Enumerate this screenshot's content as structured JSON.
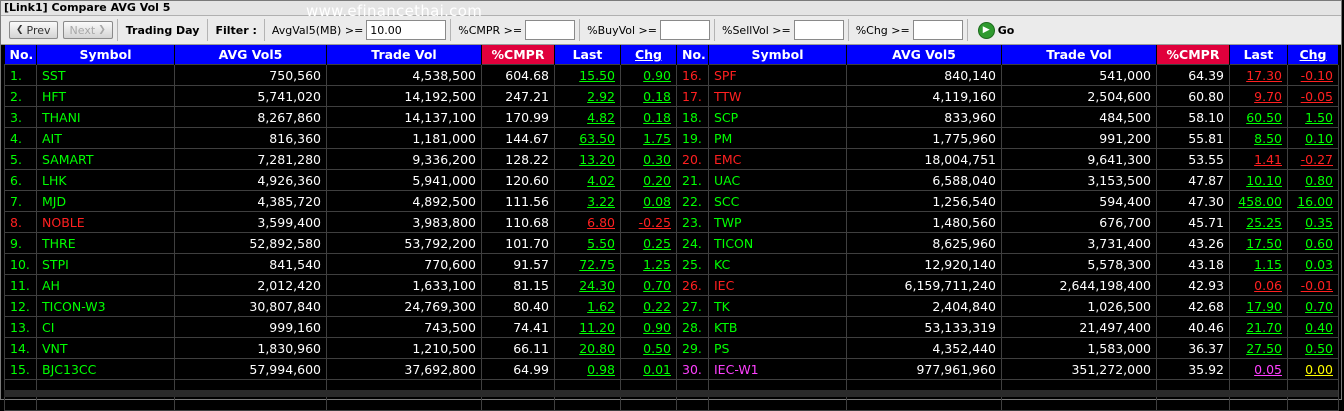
{
  "window": {
    "title": "[Link1] Compare AVG Vol 5"
  },
  "watermark": "www.efinancethai.com",
  "toolbar": {
    "prev_label": "Prev",
    "next_label": "Next",
    "trading_day": "Trading Day",
    "filter_label": "Filter :",
    "avgval_label": "AvgVal5(MB) >=",
    "avgval_value": "10.00",
    "cmpr_label": "%CMPR >=",
    "cmpr_value": "",
    "buyvol_label": "%BuyVol >=",
    "buyvol_value": "",
    "sellvol_label": "%SellVol >=",
    "sellvol_value": "",
    "chg_label": "%Chg >=",
    "chg_value": "",
    "go_label": "Go"
  },
  "colors": {
    "header_bg": "#0000ff",
    "cmpr_header_bg": "#e0003c",
    "up": "#00ff00",
    "down": "#ff2020",
    "ceiling": "#ff40ff",
    "unchanged": "#ffff00"
  },
  "columns": [
    "No.",
    "Symbol",
    "AVG Vol5",
    "Trade Vol",
    "%CMPR",
    "Last",
    "Chg"
  ],
  "rows": [
    [
      {
        "no": "1.",
        "symbol": "SST",
        "avg": "750,560",
        "trade": "4,538,500",
        "cmpr": "604.68",
        "last": "15.50",
        "chg": "0.90",
        "dir": "up"
      },
      {
        "no": "16.",
        "symbol": "SPF",
        "avg": "840,140",
        "trade": "541,000",
        "cmpr": "64.39",
        "last": "17.30",
        "chg": "-0.10",
        "dir": "down"
      }
    ],
    [
      {
        "no": "2.",
        "symbol": "HFT",
        "avg": "5,741,020",
        "trade": "14,192,500",
        "cmpr": "247.21",
        "last": "2.92",
        "chg": "0.18",
        "dir": "up"
      },
      {
        "no": "17.",
        "symbol": "TTW",
        "avg": "4,119,160",
        "trade": "2,504,600",
        "cmpr": "60.80",
        "last": "9.70",
        "chg": "-0.05",
        "dir": "down"
      }
    ],
    [
      {
        "no": "3.",
        "symbol": "THANI",
        "avg": "8,267,860",
        "trade": "14,137,100",
        "cmpr": "170.99",
        "last": "4.82",
        "chg": "0.18",
        "dir": "up"
      },
      {
        "no": "18.",
        "symbol": "SCP",
        "avg": "833,960",
        "trade": "484,500",
        "cmpr": "58.10",
        "last": "60.50",
        "chg": "1.50",
        "dir": "up"
      }
    ],
    [
      {
        "no": "4.",
        "symbol": "AIT",
        "avg": "816,360",
        "trade": "1,181,000",
        "cmpr": "144.67",
        "last": "63.50",
        "chg": "1.75",
        "dir": "up"
      },
      {
        "no": "19.",
        "symbol": "PM",
        "avg": "1,775,960",
        "trade": "991,200",
        "cmpr": "55.81",
        "last": "8.50",
        "chg": "0.10",
        "dir": "up"
      }
    ],
    [
      {
        "no": "5.",
        "symbol": "SAMART",
        "avg": "7,281,280",
        "trade": "9,336,200",
        "cmpr": "128.22",
        "last": "13.20",
        "chg": "0.30",
        "dir": "up"
      },
      {
        "no": "20.",
        "symbol": "EMC",
        "avg": "18,004,751",
        "trade": "9,641,300",
        "cmpr": "53.55",
        "last": "1.41",
        "chg": "-0.27",
        "dir": "down"
      }
    ],
    [
      {
        "no": "6.",
        "symbol": "LHK",
        "avg": "4,926,360",
        "trade": "5,941,000",
        "cmpr": "120.60",
        "last": "4.02",
        "chg": "0.20",
        "dir": "up"
      },
      {
        "no": "21.",
        "symbol": "UAC",
        "avg": "6,588,040",
        "trade": "3,153,500",
        "cmpr": "47.87",
        "last": "10.10",
        "chg": "0.80",
        "dir": "up"
      }
    ],
    [
      {
        "no": "7.",
        "symbol": "MJD",
        "avg": "4,385,720",
        "trade": "4,892,500",
        "cmpr": "111.56",
        "last": "3.22",
        "chg": "0.08",
        "dir": "up"
      },
      {
        "no": "22.",
        "symbol": "SCC",
        "avg": "1,256,540",
        "trade": "594,400",
        "cmpr": "47.30",
        "last": "458.00",
        "chg": "16.00",
        "dir": "up"
      }
    ],
    [
      {
        "no": "8.",
        "symbol": "NOBLE",
        "avg": "3,599,400",
        "trade": "3,983,800",
        "cmpr": "110.68",
        "last": "6.80",
        "chg": "-0.25",
        "dir": "down"
      },
      {
        "no": "23.",
        "symbol": "TWP",
        "avg": "1,480,560",
        "trade": "676,700",
        "cmpr": "45.71",
        "last": "25.25",
        "chg": "0.35",
        "dir": "up"
      }
    ],
    [
      {
        "no": "9.",
        "symbol": "THRE",
        "avg": "52,892,580",
        "trade": "53,792,200",
        "cmpr": "101.70",
        "last": "5.50",
        "chg": "0.25",
        "dir": "up"
      },
      {
        "no": "24.",
        "symbol": "TICON",
        "avg": "8,625,960",
        "trade": "3,731,400",
        "cmpr": "43.26",
        "last": "17.50",
        "chg": "0.60",
        "dir": "up"
      }
    ],
    [
      {
        "no": "10.",
        "symbol": "STPI",
        "avg": "841,540",
        "trade": "770,600",
        "cmpr": "91.57",
        "last": "72.75",
        "chg": "1.25",
        "dir": "up"
      },
      {
        "no": "25.",
        "symbol": "KC",
        "avg": "12,920,140",
        "trade": "5,578,300",
        "cmpr": "43.18",
        "last": "1.15",
        "chg": "0.03",
        "dir": "up"
      }
    ],
    [
      {
        "no": "11.",
        "symbol": "AH",
        "avg": "2,012,420",
        "trade": "1,633,100",
        "cmpr": "81.15",
        "last": "24.30",
        "chg": "0.70",
        "dir": "up"
      },
      {
        "no": "26.",
        "symbol": "IEC",
        "avg": "6,159,711,240",
        "trade": "2,644,198,400",
        "cmpr": "42.93",
        "last": "0.06",
        "chg": "-0.01",
        "dir": "down"
      }
    ],
    [
      {
        "no": "12.",
        "symbol": "TICON-W3",
        "avg": "30,807,840",
        "trade": "24,769,300",
        "cmpr": "80.40",
        "last": "1.62",
        "chg": "0.22",
        "dir": "up"
      },
      {
        "no": "27.",
        "symbol": "TK",
        "avg": "2,404,840",
        "trade": "1,026,500",
        "cmpr": "42.68",
        "last": "17.90",
        "chg": "0.70",
        "dir": "up"
      }
    ],
    [
      {
        "no": "13.",
        "symbol": "CI",
        "avg": "999,160",
        "trade": "743,500",
        "cmpr": "74.41",
        "last": "11.20",
        "chg": "0.90",
        "dir": "up"
      },
      {
        "no": "28.",
        "symbol": "KTB",
        "avg": "53,133,319",
        "trade": "21,497,400",
        "cmpr": "40.46",
        "last": "21.70",
        "chg": "0.40",
        "dir": "up"
      }
    ],
    [
      {
        "no": "14.",
        "symbol": "VNT",
        "avg": "1,830,960",
        "trade": "1,210,500",
        "cmpr": "66.11",
        "last": "20.80",
        "chg": "0.50",
        "dir": "up"
      },
      {
        "no": "29.",
        "symbol": "PS",
        "avg": "4,352,440",
        "trade": "1,583,000",
        "cmpr": "36.37",
        "last": "27.50",
        "chg": "0.50",
        "dir": "up"
      }
    ],
    [
      {
        "no": "15.",
        "symbol": "BJC13CC",
        "avg": "57,994,600",
        "trade": "37,692,800",
        "cmpr": "64.99",
        "last": "0.98",
        "chg": "0.01",
        "dir": "up"
      },
      {
        "no": "30.",
        "symbol": "IEC-W1",
        "avg": "977,961,960",
        "trade": "351,272,000",
        "cmpr": "35.92",
        "last": "0.05",
        "chg": "0.00",
        "dir": "mixed"
      }
    ]
  ]
}
